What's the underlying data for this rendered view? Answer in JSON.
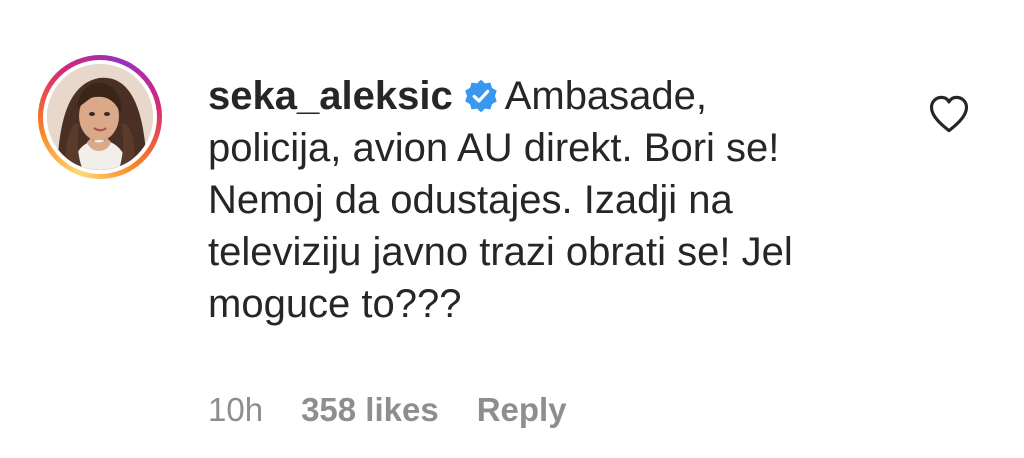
{
  "comment": {
    "username": "seka_aleksic",
    "verified_icon": "verified-badge-icon",
    "text": "Ambasade, policija, avion AU direkt. Bori se! Nemoj da odustajes. Izadji na televiziju javno trazi obrati se! Jel moguce to???",
    "like_icon": "heart-outline-icon",
    "time": "10h",
    "likes": "358 likes",
    "reply_label": "Reply"
  },
  "colors": {
    "text": "#262626",
    "meta": "#8e8e8e",
    "verified": "#3897f0",
    "ring_start": "#feda75",
    "ring_end": "#962fbf"
  }
}
